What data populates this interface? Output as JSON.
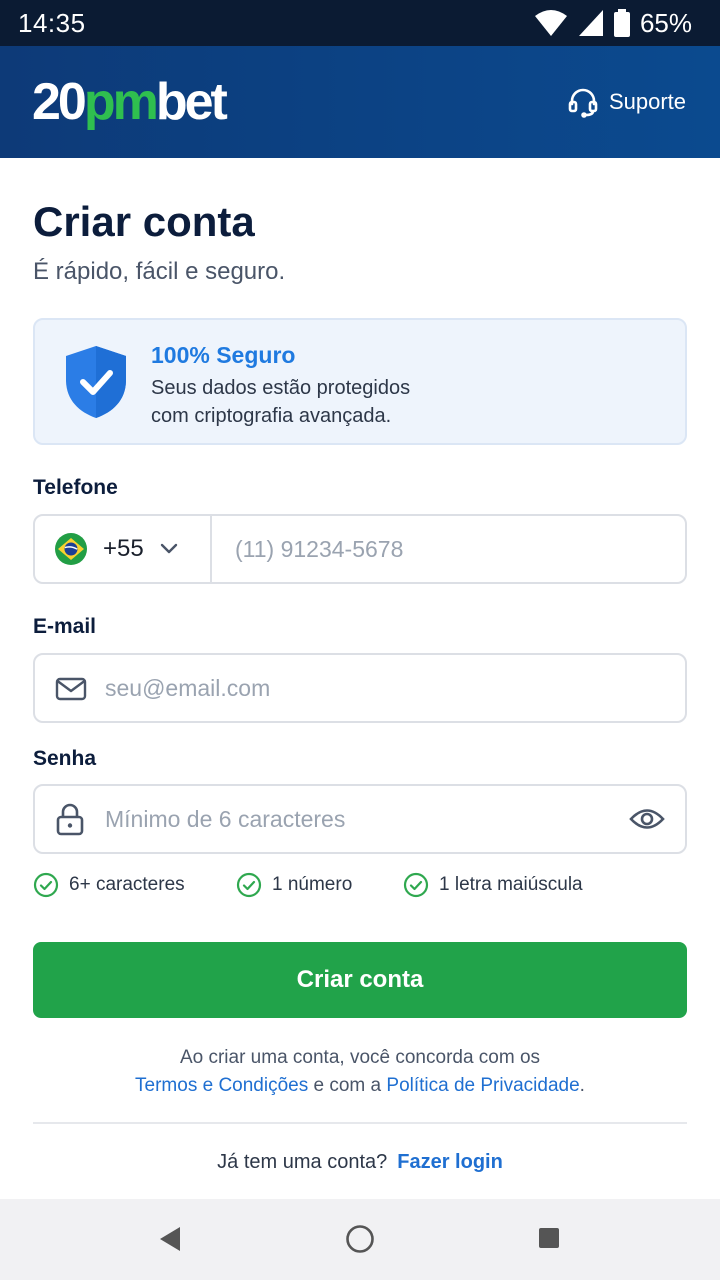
{
  "status_bar": {
    "time": "14:35",
    "battery": "65%"
  },
  "header": {
    "logo_part1": "20",
    "logo_part2": "pm",
    "logo_part3": "bet",
    "support_label": "Suporte"
  },
  "page": {
    "title": "Criar conta",
    "subtitle": "É rápido, fácil e seguro."
  },
  "security_notice": {
    "title": "100% Seguro",
    "line1": "Seus dados estão protegidos",
    "line2": "com criptografia avançada."
  },
  "form": {
    "phone": {
      "label": "Telefone",
      "country_code": "+55",
      "placeholder": "(11) 91234-5678"
    },
    "email": {
      "label": "E-mail",
      "placeholder": "seu@email.com"
    },
    "password": {
      "label": "Senha",
      "placeholder": "Mínimo de 6 caracteres"
    },
    "rules": [
      "6+ caracteres",
      "1 número",
      "1 letra maiúscula"
    ],
    "submit_label": "Criar conta"
  },
  "terms": {
    "line1": "Ao criar uma conta, você concorda com os",
    "terms_link": "Termos e Condições",
    "middle": " e com a ",
    "privacy_link": "Política de Privacidade",
    "end": "."
  },
  "login": {
    "prompt": "Já tem uma conta?",
    "link": "Fazer login"
  },
  "colors": {
    "header": "#0b4a8f",
    "accent_green": "#21a34a",
    "link_blue": "#1f6fd1",
    "check_green": "#2fa84f"
  }
}
